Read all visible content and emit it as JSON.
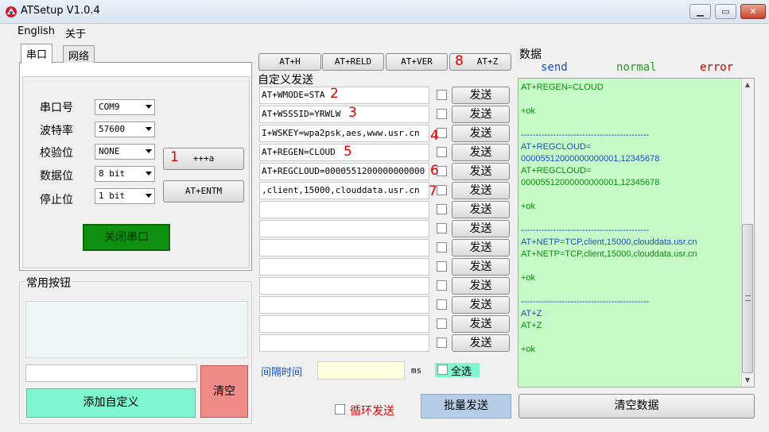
{
  "window": {
    "title": "ATSetup V1.0.4"
  },
  "menu": {
    "items": [
      "English",
      "关于"
    ]
  },
  "tabs": [
    {
      "label": "串口",
      "active": true
    },
    {
      "label": "网络",
      "active": false
    }
  ],
  "serial": {
    "fields": [
      {
        "label": "串口号",
        "value": "COM9"
      },
      {
        "label": "波特率",
        "value": "57600"
      },
      {
        "label": "校验位",
        "value": "NONE"
      },
      {
        "label": "数据位",
        "value": "8 bit"
      },
      {
        "label": "停止位",
        "value": "1 bit"
      }
    ],
    "plus_button": "+++a",
    "entm_button": "AT+ENTM",
    "close_port_button": "关闭串口"
  },
  "common_buttons": {
    "title": "常用按钮",
    "input_value": "",
    "add_button": "添加自定义",
    "clear_button": "清空"
  },
  "quick_commands": [
    "AT+H",
    "AT+RELD",
    "AT+VER",
    "AT+Z"
  ],
  "custom_send": {
    "title": "自定义发送",
    "send_label": "发送",
    "commands": [
      "AT+WMODE=STA",
      "AT+WSSSID=YRWLW",
      "I+WSKEY=wpa2psk,aes,www.usr.cn",
      "AT+REGEN=CLOUD",
      "AT+REGCLOUD=0000551200000000000",
      ",client,15000,clouddata.usr.cn",
      "",
      "",
      "",
      "",
      "",
      "",
      "",
      ""
    ],
    "interval_label": "间隔时间",
    "interval_value": "",
    "interval_unit": "ms",
    "select_all_label": "全选",
    "loop_label": "循环发送",
    "batch_button": "批量发送"
  },
  "annotations": [
    "1",
    "2",
    "3",
    "4",
    "5",
    "6",
    "7",
    "8"
  ],
  "data_panel": {
    "title": "数据",
    "legend": {
      "send": "send",
      "normal": "normal",
      "error": "error"
    },
    "lines": [
      {
        "text": "AT+REGEN=CLOUD",
        "kind": "normal"
      },
      {
        "text": "",
        "kind": "normal"
      },
      {
        "text": "+ok",
        "kind": "normal"
      },
      {
        "text": "",
        "kind": "normal"
      },
      {
        "text": "--------------------------------------------",
        "kind": "sep"
      },
      {
        "text": "AT+REGCLOUD=",
        "kind": "send"
      },
      {
        "text": "00005512000000000001,12345678",
        "kind": "send"
      },
      {
        "text": "AT+REGCLOUD=",
        "kind": "normal"
      },
      {
        "text": "00005512000000000001,12345678",
        "kind": "normal"
      },
      {
        "text": "",
        "kind": "normal"
      },
      {
        "text": "+ok",
        "kind": "normal"
      },
      {
        "text": "",
        "kind": "normal"
      },
      {
        "text": "--------------------------------------------",
        "kind": "sep"
      },
      {
        "text": "AT+NETP=TCP,client,15000,clouddata.usr.cn",
        "kind": "send"
      },
      {
        "text": "AT+NETP=TCP,client,15000,clouddata.usr.cn",
        "kind": "normal"
      },
      {
        "text": "",
        "kind": "normal"
      },
      {
        "text": "+ok",
        "kind": "normal"
      },
      {
        "text": "",
        "kind": "normal"
      },
      {
        "text": "--------------------------------------------",
        "kind": "sep"
      },
      {
        "text": "AT+Z",
        "kind": "send"
      },
      {
        "text": "AT+Z",
        "kind": "normal"
      },
      {
        "text": "",
        "kind": "normal"
      },
      {
        "text": "+ok",
        "kind": "normal"
      }
    ],
    "clear_button": "清空数据"
  },
  "colors": {
    "send": "#1a4fbf",
    "normal": "#0b8a0b",
    "error": "#d00000",
    "data_bg": "#c6fbc8"
  },
  "icons": {
    "app": "app-logo-icon",
    "min": "minimize-icon",
    "max": "maximize-icon",
    "close": "close-icon"
  }
}
